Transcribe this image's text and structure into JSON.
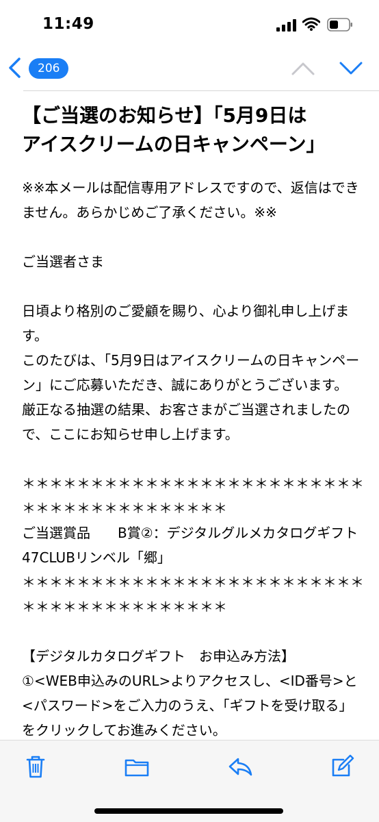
{
  "status_bar": {
    "time": "11:49"
  },
  "nav": {
    "unread_count": "206"
  },
  "email": {
    "subject_line1": "【ご当選のお知らせ】「5月9日は",
    "subject_line2": "アイスクリームの日キャンペーン」",
    "body": "※※本メールは配信専用アドレスですので、返信はできません。あらかじめご了承ください。※※\n\nご当選者さま\n\n日頃より格別のご愛顧を賜り、心より御礼申し上げます。\nこのたびは、「5月9日はアイスクリームの日キャンペーン」にご応募いただき、誠にありがとうございます。\n厳正なる抽選の結果、お客さまがご当選されましたので、ここにお知らせ申し上げます。\n\n＊＊＊＊＊＊＊＊＊＊＊＊＊＊＊＊＊＊＊＊＊＊＊＊＊＊＊＊＊＊＊＊＊＊＊＊＊＊＊＊\nご当選賞品　　B賞②：デジタルグルメカタログギフト　47CLUBリンベル「郷」\n＊＊＊＊＊＊＊＊＊＊＊＊＊＊＊＊＊＊＊＊＊＊＊＊＊＊＊＊＊＊＊＊＊＊＊＊＊＊＊＊\n\n【デジタルカタログギフト　お申込み方法】\n①<WEB申込みのURL>よりアクセスし、<ID番号>と<パスワード>をご入力のうえ、「ギフトを受け取る」をクリックしてお進みください。"
  },
  "colors": {
    "accent": "#1a7ef5"
  },
  "toolbar_icons": [
    "trash-icon",
    "folder-icon",
    "reply-icon",
    "compose-icon"
  ]
}
